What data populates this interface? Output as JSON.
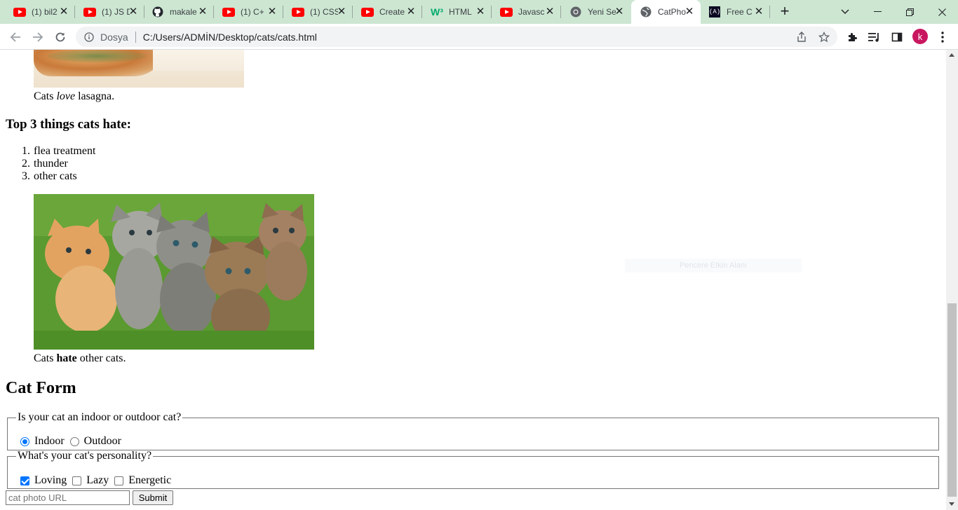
{
  "browser": {
    "tabs": [
      {
        "title": "(1) bil2",
        "icon": "youtube-icon"
      },
      {
        "title": "(1) JS D",
        "icon": "youtube-icon"
      },
      {
        "title": "makale",
        "icon": "github-icon"
      },
      {
        "title": "(1) C+",
        "icon": "youtube-icon"
      },
      {
        "title": "(1) CSS",
        "icon": "youtube-icon"
      },
      {
        "title": "Create",
        "icon": "youtube-icon"
      },
      {
        "title": "HTML",
        "icon": "w3schools-icon"
      },
      {
        "title": "Javasc",
        "icon": "youtube-icon"
      },
      {
        "title": "Yeni Se",
        "icon": "chrome-icon"
      },
      {
        "title": "CatPho",
        "icon": "globe-icon",
        "active": true
      },
      {
        "title": "Free C",
        "icon": "freecodecamp-icon"
      }
    ],
    "address": {
      "security_label": "Dosya",
      "url": "C:/Users/ADMİN/Desktop/cats/cats.html"
    },
    "profile_initial": "k",
    "colors": {
      "tabstrip": "#cce6d2",
      "avatar": "#c8175f",
      "accent": "#0075ff"
    }
  },
  "page": {
    "lasagna_caption": {
      "pre": "Cats ",
      "em": "love",
      "post": " lasagna."
    },
    "hate_heading": "Top 3 things cats hate:",
    "hate_list": [
      "flea treatment",
      "thunder",
      "other cats"
    ],
    "list_numbers": [
      "1.",
      "2.",
      "3."
    ],
    "cats_caption": {
      "pre": "Cats ",
      "strong": "hate",
      "post": " other cats."
    },
    "form_heading": "Cat Form",
    "fieldset_indoor": {
      "legend": "Is your cat an indoor or outdoor cat?",
      "options": [
        {
          "label": "Indoor",
          "checked": true
        },
        {
          "label": "Outdoor",
          "checked": false
        }
      ]
    },
    "fieldset_personality": {
      "legend": "What's your cat's personality?",
      "options": [
        {
          "label": "Loving",
          "checked": true
        },
        {
          "label": "Lazy",
          "checked": false
        },
        {
          "label": "Energetic",
          "checked": false
        }
      ]
    },
    "url_input": {
      "placeholder": "cat photo URL",
      "value": ""
    },
    "submit_label": "Submit",
    "ghost_text": "Pencere Etkin Alanı"
  }
}
